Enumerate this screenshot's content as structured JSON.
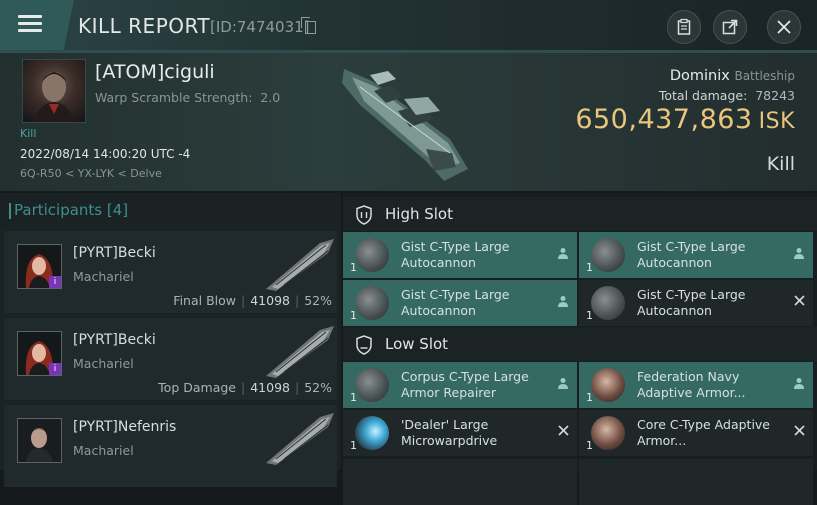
{
  "window": {
    "title": "KILL REPORT",
    "id_label": "[ID:7474031]"
  },
  "victim": {
    "name": "[ATOM]ciguli",
    "warp_scramble_label": "Warp Scramble Strength:",
    "warp_scramble_value": "2.0",
    "kill_tag": "Kill",
    "datetime": "2022/08/14 14:00:20 UTC -4",
    "location": "6Q-R50 < YX-LYK < Delve",
    "ship_name": "Dominix",
    "ship_class": "Battleship",
    "total_damage_label": "Total damage:",
    "total_damage": "78243",
    "isk_value": "650,437,863",
    "isk_unit": "ISK",
    "result": "Kill"
  },
  "participants": {
    "header": "Participants",
    "count": "[4]",
    "items": [
      {
        "name": "[PYRT]Becki",
        "ship": "Machariel",
        "role": "Final Blow",
        "damage": "41098",
        "percent": "52%",
        "badge": "i"
      },
      {
        "name": "[PYRT]Becki",
        "ship": "Machariel",
        "role": "Top Damage",
        "damage": "41098",
        "percent": "52%",
        "badge": "i"
      },
      {
        "name": "[PYRT]Nefenris",
        "ship": "Machariel",
        "role": "",
        "damage": "",
        "percent": "",
        "badge": ""
      }
    ]
  },
  "fitting": {
    "high_slot": {
      "label": "High Slot",
      "modules": [
        {
          "name": "Gist C-Type Large Autocannon",
          "qty": "1",
          "state": "dropped"
        },
        {
          "name": "Gist C-Type Large Autocannon",
          "qty": "1",
          "state": "dropped"
        },
        {
          "name": "Gist C-Type Large Autocannon",
          "qty": "1",
          "state": "dropped"
        },
        {
          "name": "Gist C-Type Large Autocannon",
          "qty": "1",
          "state": "destroyed"
        }
      ]
    },
    "low_slot": {
      "label": "Low Slot",
      "modules": [
        {
          "name": "Corpus C-Type Large Armor Repairer",
          "qty": "1",
          "state": "dropped"
        },
        {
          "name": "Federation Navy Adaptive Armor...",
          "qty": "1",
          "state": "dropped"
        },
        {
          "name": "'Dealer' Large Microwarpdrive",
          "qty": "1",
          "state": "destroyed"
        },
        {
          "name": "Core C-Type Adaptive Armor...",
          "qty": "1",
          "state": "destroyed"
        }
      ]
    }
  },
  "colors": {
    "accent_teal": "#356a63",
    "isk_gold": "#e9c57d",
    "participant_teal": "#3f8f8c"
  },
  "icons": {
    "menu": "hamburger-icon",
    "copy": "copy-icon",
    "clipboard": "clipboard-icon",
    "external": "external-link-icon",
    "close": "close-icon",
    "shield": "shield-icon",
    "dropped": "person-icon",
    "destroyed": "x-icon"
  }
}
